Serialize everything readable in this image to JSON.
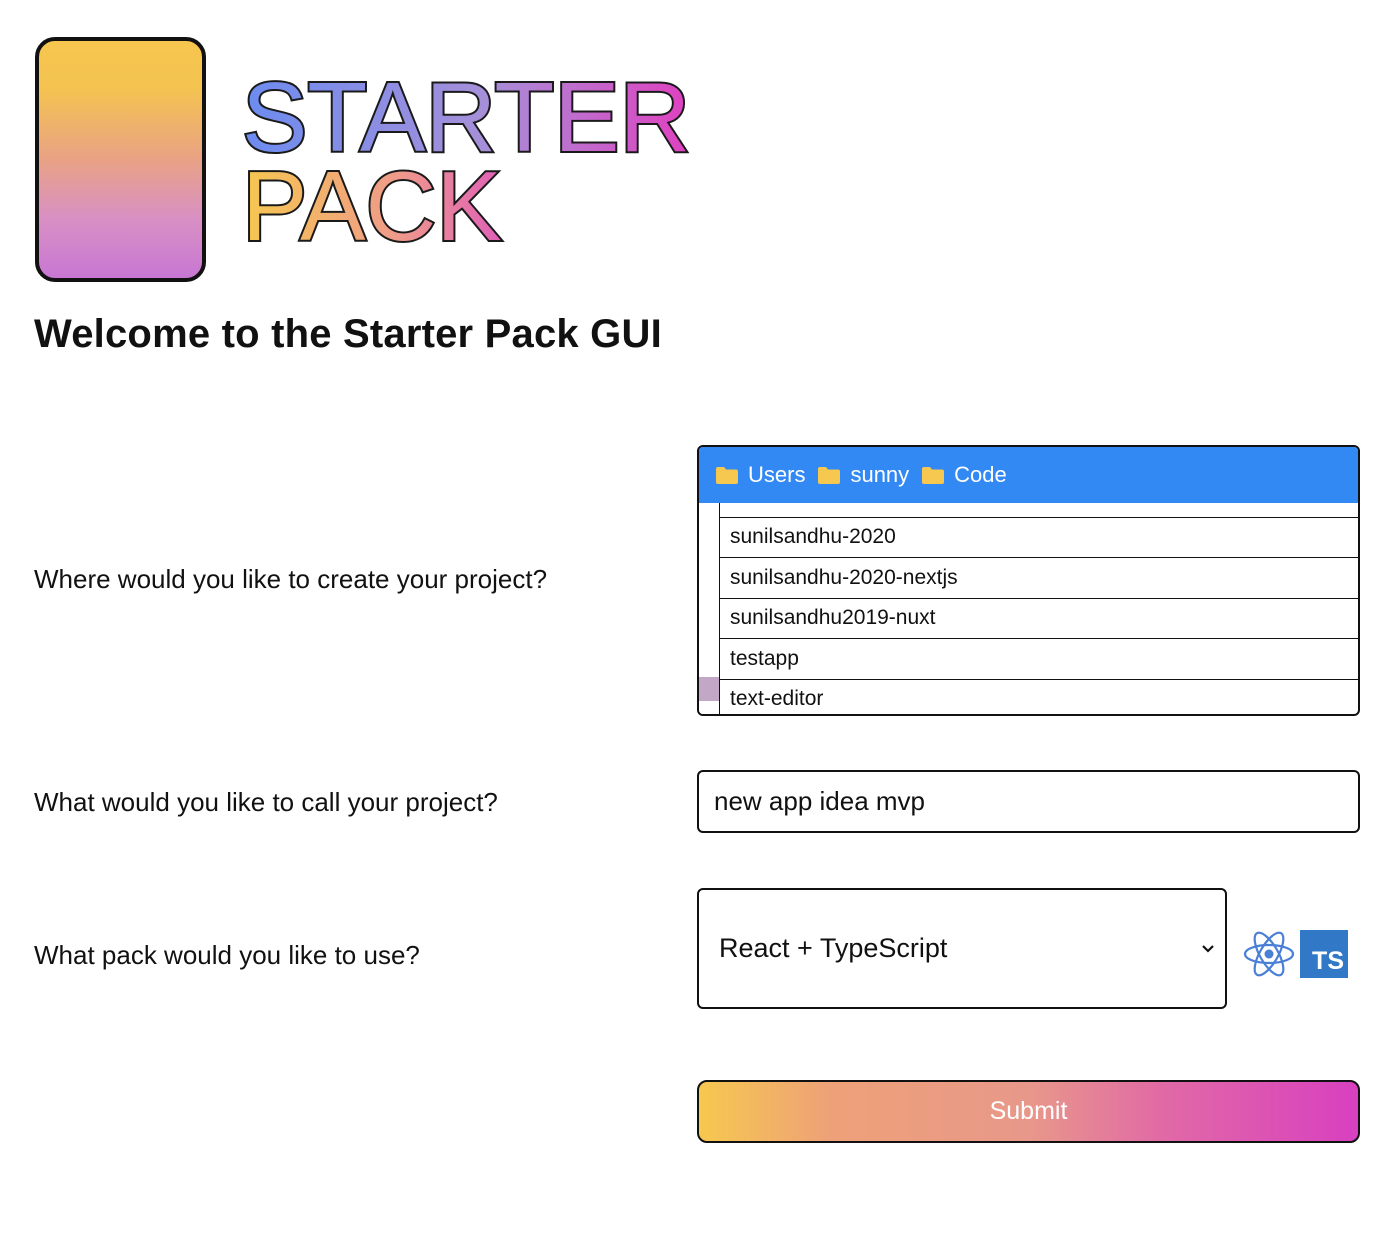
{
  "brand": {
    "logo_line1": "STARTER",
    "logo_line2": "PACK",
    "card_gradient": [
      "#f6c64f",
      "#e9a285",
      "#c877d3"
    ]
  },
  "page_title": "Welcome to the Starter Pack GUI",
  "location": {
    "question": "Where would you like to create your project?",
    "breadcrumb": [
      {
        "label": "Users",
        "icon": "folder-icon"
      },
      {
        "label": "sunny",
        "icon": "folder-icon"
      },
      {
        "label": "Code",
        "icon": "folder-icon"
      }
    ],
    "directories": [
      "",
      "sunilsandhu-2020",
      "sunilsandhu-2020-nextjs",
      "sunilsandhu2019-nuxt",
      "testapp",
      "text-editor"
    ],
    "header_color": "#3389f4"
  },
  "name": {
    "question": "What would you like to call your project?",
    "value": "new app idea mvp"
  },
  "pack": {
    "question": "What pack would you like to use?",
    "selected": "React + TypeScript",
    "icons": [
      "react-icon",
      "typescript-icon"
    ],
    "ts_badge": "TS"
  },
  "submit": {
    "label": "Submit"
  }
}
